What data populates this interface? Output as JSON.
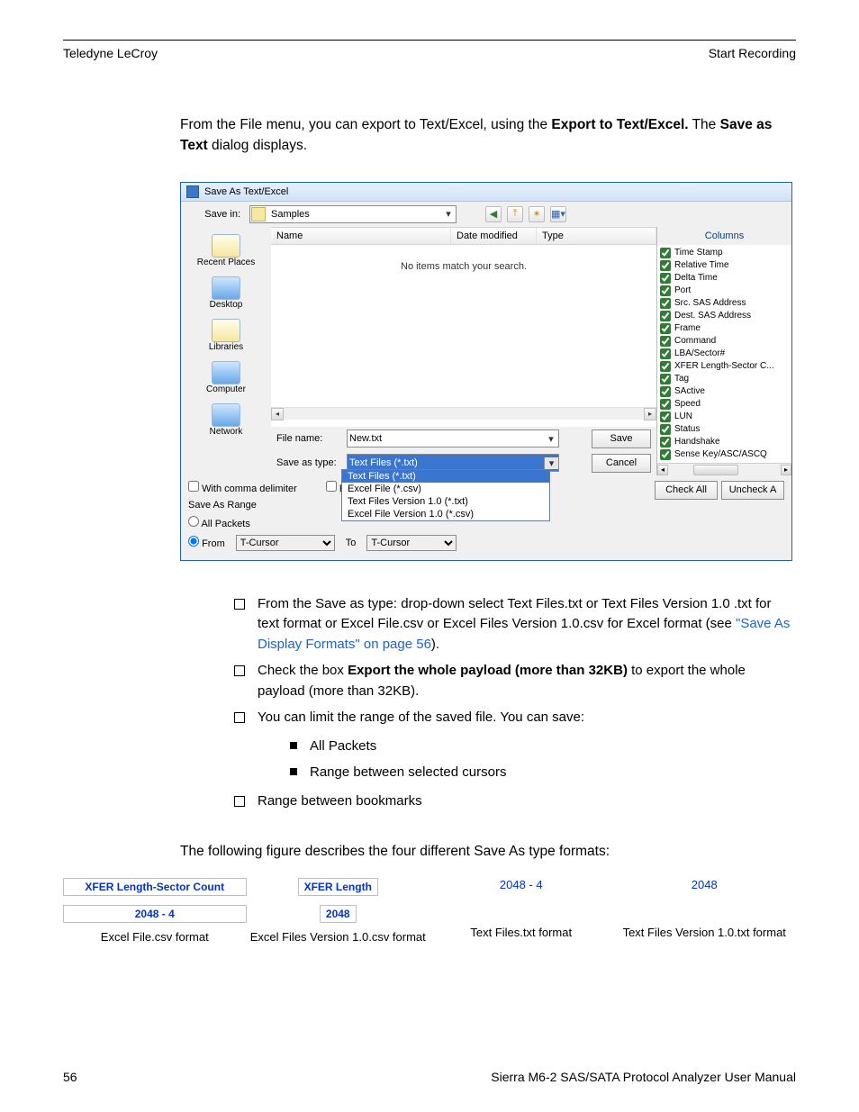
{
  "header": {
    "left": "Teledyne LeCroy",
    "right": "Start Recording"
  },
  "intro": {
    "pre": "From the File menu, you can export to Text/Excel, using the ",
    "bold1": "Export to Text/Excel.",
    "mid": " The ",
    "bold2": "Save as Text",
    "post": " dialog displays."
  },
  "dlg": {
    "title": "Save As Text/Excel",
    "saveInLabel": "Save in:",
    "saveInValue": "Samples",
    "nav": [
      "Recent Places",
      "Desktop",
      "Libraries",
      "Computer",
      "Network"
    ],
    "hdrName": "Name",
    "hdrDate": "Date modified",
    "hdrType": "Type",
    "noitems": "No items match your search.",
    "fileNameLabel": "File name:",
    "fileNameValue": "New.txt",
    "saveTypeLabel": "Save as type:",
    "saveTypeValue": "Text Files (*.txt)",
    "typeOpts": [
      "Text Files (*.txt)",
      "Excel File (*.csv)",
      "Text Files Version 1.0 (*.txt)",
      "Excel File Version 1.0 (*.csv)"
    ],
    "save": "Save",
    "cancel": "Cancel",
    "colsTitle": "Columns",
    "cols": [
      "Time Stamp",
      "Relative Time",
      "Delta Time",
      "Port",
      "Src. SAS Address",
      "Dest. SAS Address",
      "Frame",
      "Command",
      "LBA/Sector#",
      "XFER Length-Sector C...",
      "Tag",
      "SActive",
      "Speed",
      "LUN",
      "Status",
      "Handshake",
      "Sense Key/ASC/ASCQ"
    ],
    "checkAll": "Check All",
    "uncheckAll": "Uncheck A",
    "withComma": "With comma delimiter",
    "exportDu": "Export Du",
    "saveAsRange": "Save As Range",
    "allPackets": "All Packets",
    "from": "From",
    "to": "To",
    "cursor": "T-Cursor"
  },
  "b1a": "From the Save as type: drop-down select Text Files.txt or Text Files Version 1.0 .txt for text format or Excel File.csv or Excel Files Version 1.0.csv for Excel format (see ",
  "b1link": "\"Save As Display Formats\" on page 56",
  "b1b": ").",
  "b2a": "Check the box ",
  "b2bold": "Export the whole payload (more than 32KB)",
  "b2b": " to export the whole payload (more than 32KB).",
  "b3": "You can limit the range of the saved file. You can save:",
  "b3s1": "All Packets",
  "b3s2": "Range between selected cursors",
  "b4": "Range between bookmarks",
  "caption": "The following figure describes the four different Save As type formats:",
  "f": {
    "h1": "XFER Length-Sector Count",
    "h2": "XFER Length",
    "h3": "2048  -  4",
    "h4": "2048",
    "v1": "2048 - 4",
    "v2": "2048",
    "l1": "Excel File.csv format",
    "l2": "Excel Files Version 1.0.csv format",
    "l3": "Text Files.txt format",
    "l4": "Text Files Version 1.0.txt format"
  },
  "foot": {
    "page": "56",
    "title": "Sierra M6-2 SAS/SATA Protocol Analyzer User Manual"
  }
}
